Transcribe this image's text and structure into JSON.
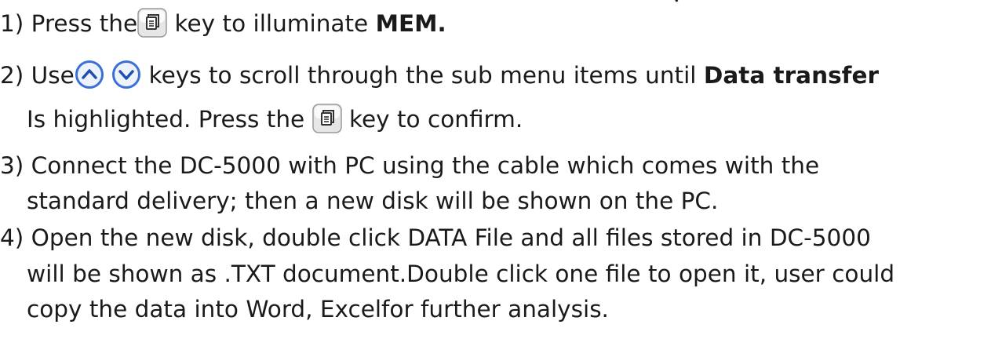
{
  "steps": [
    {
      "number": "1)",
      "before": "Press the",
      "after": " key to illuminate ",
      "bold": "MEM."
    },
    {
      "number": "2)",
      "before": "Use",
      "after": " keys to scroll through the sub menu items until ",
      "bold": "Data transfer",
      "cont_before": "Is highlighted. Press the ",
      "cont_after": " key to confirm."
    },
    {
      "number": "3)",
      "line1": "Connect the DC-5000 with PC using the cable which comes with the",
      "line2": "standard delivery; then a new disk will be shown on the PC."
    },
    {
      "number": "4)",
      "line1": "Open the new disk, double click DATA File and all files stored in DC-5000",
      "line2": "will be shown as .TXT document.Double click one file to open it, user could",
      "line3": "copy the data into Word, Excelfor further analysis."
    }
  ],
  "icons": {
    "mem_key": "mem-key-icon",
    "up_key": "up-arrow-key-icon",
    "down_key": "down-arrow-key-icon"
  },
  "colors": {
    "key_ring": "#3a6fd8",
    "key_fill": "#eef3fb",
    "text": "#1a1a1a"
  }
}
